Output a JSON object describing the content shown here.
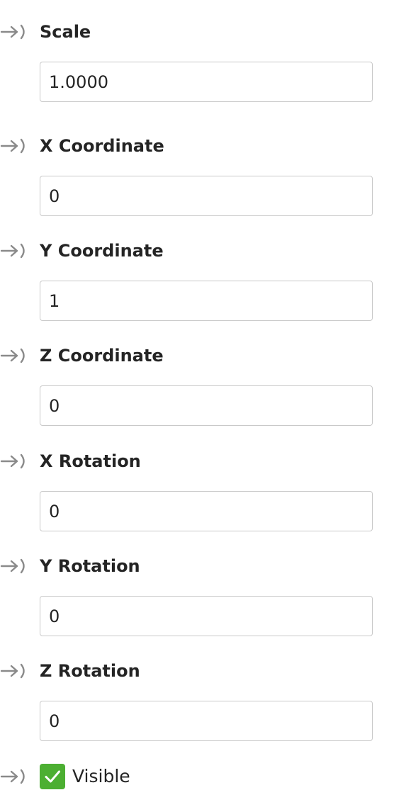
{
  "fields": [
    {
      "label": "Scale",
      "value": "1.0000"
    },
    {
      "label": "X Coordinate",
      "value": "0"
    },
    {
      "label": "Y Coordinate",
      "value": "1"
    },
    {
      "label": "Z Coordinate",
      "value": "0"
    },
    {
      "label": "X Rotation",
      "value": "0"
    },
    {
      "label": "Y Rotation",
      "value": "0"
    },
    {
      "label": "Z Rotation",
      "value": "0"
    }
  ],
  "visible": {
    "label": "Visible",
    "checked": true
  },
  "icons": {
    "socket": "arrow-socket-icon",
    "check": "checkmark-icon"
  },
  "colors": {
    "checkbox": "#4caf32",
    "icon": "#8a8a8a",
    "border": "#c9c9c9"
  }
}
